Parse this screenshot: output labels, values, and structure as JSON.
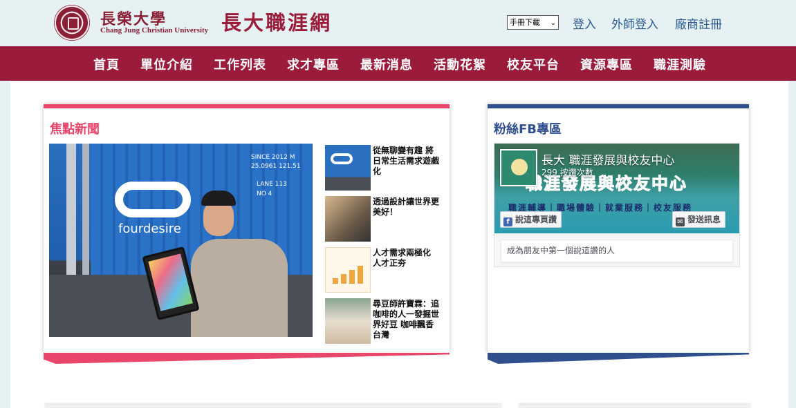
{
  "header": {
    "university_cn": "長榮大學",
    "university_en": "Chang Jung Christian University",
    "site_title": "長大職涯網",
    "manual_select": "手冊下載",
    "links": {
      "login": "登入",
      "external_teacher_login": "外師登入",
      "vendor_register": "廠商註冊"
    }
  },
  "nav": {
    "items": [
      "首頁",
      "單位介紹",
      "工作列表",
      "求才專區",
      "最新消息",
      "活動花絮",
      "校友平台",
      "資源專區",
      "職涯測驗"
    ]
  },
  "news": {
    "title": "焦點新聞",
    "feature_image_text": {
      "brand": "fourdesire",
      "stencil_top": "SINCE 2012 M\n25.0961 121.51",
      "stencil_mid": "LANE 113\nNO 4"
    },
    "items": [
      {
        "title": "從無聊變有趣 將日常生活需求遊戲化"
      },
      {
        "title": "透過設計讓世界更美好！"
      },
      {
        "title": "人才需求兩極化 人才正夯"
      },
      {
        "title": "尋豆師許寶霖：追咖啡的人一發掘世界好豆 咖啡飄香台灣"
      }
    ]
  },
  "fb": {
    "title": "粉絲FB專區",
    "page_name": "長大 職涯發展與校友中心",
    "likes": "299 按讚次數",
    "cover_text": "職涯發展與校友中心",
    "cover_sub": "職涯輔導｜職場體驗｜就業服務｜校友服務",
    "like_button": "說這專頁讚",
    "message_button": "發送訊息",
    "friends_text": "成為朋友中第一個說這讚的人"
  },
  "colors": {
    "brand_red": "#9b1b3a",
    "news_accent": "#e8466a",
    "fb_accent": "#2f4f8f",
    "link_blue": "#2a5a8c"
  }
}
